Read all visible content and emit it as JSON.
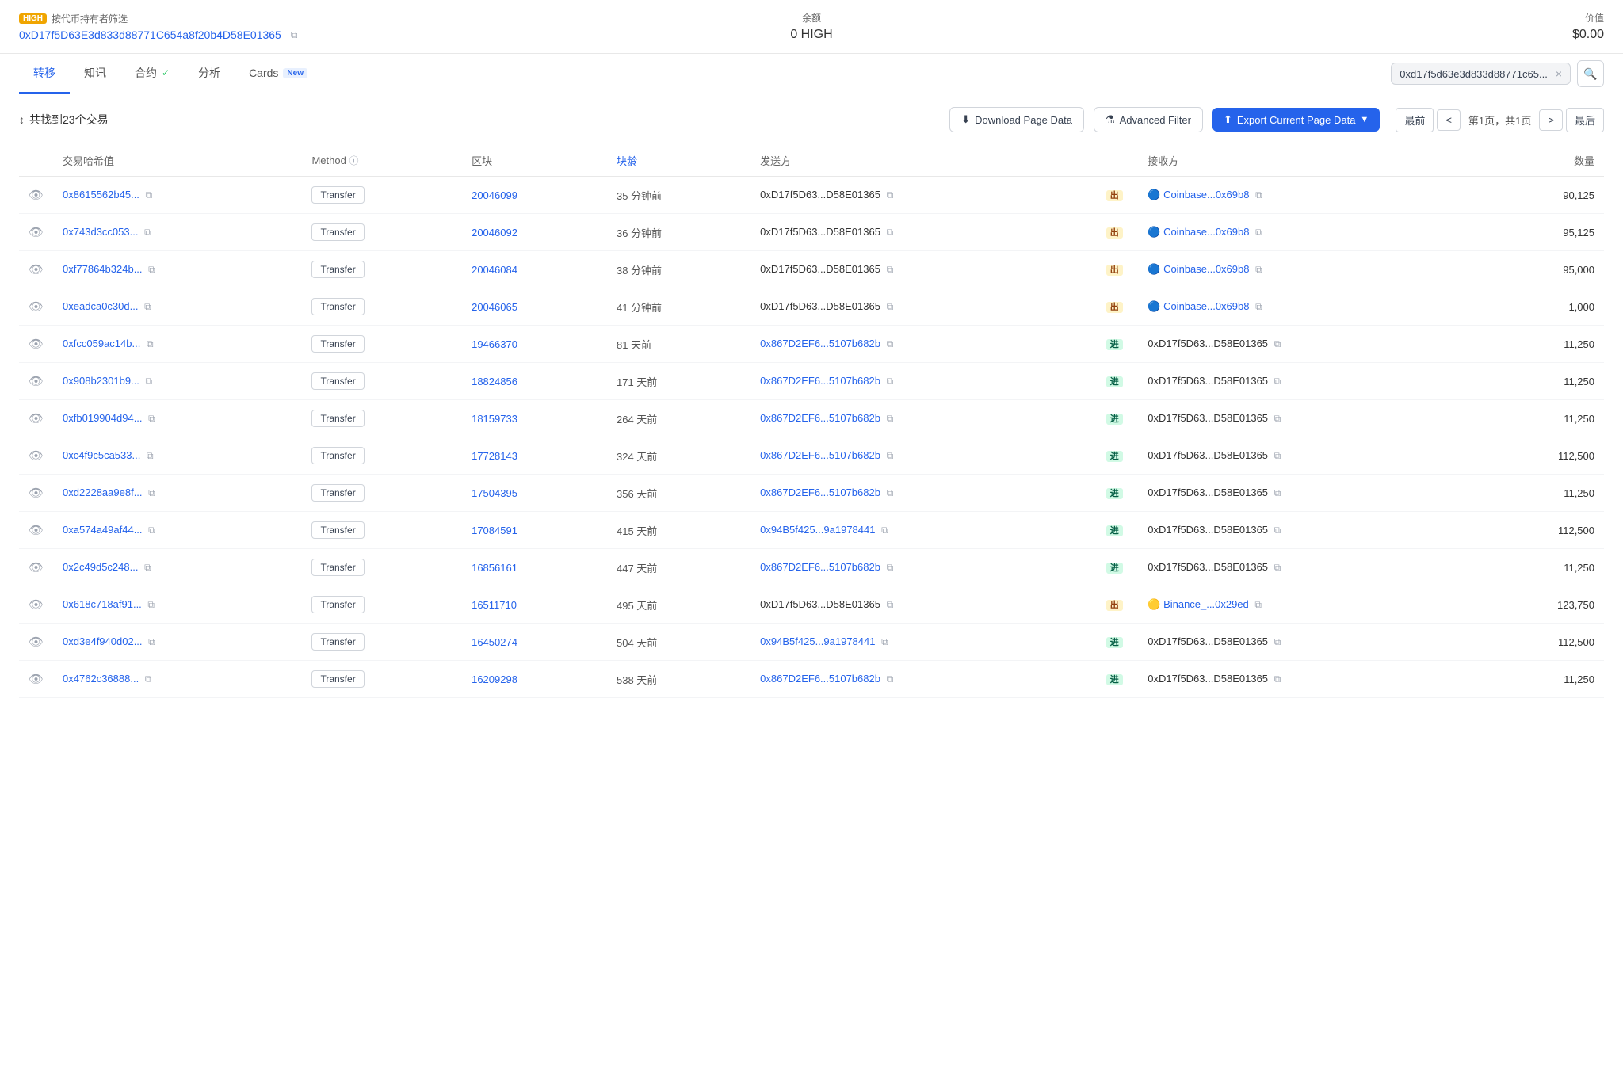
{
  "topbar": {
    "filter_label": "按代币持有者筛选",
    "coin_badge": "HIGH",
    "address": "0xD17f5D63E3d833d88771C654a8f20b4D58E01365",
    "balance_label": "余额",
    "balance_value": "0 HIGH",
    "value_label": "价值",
    "value_value": "$0.00"
  },
  "nav": {
    "tabs": [
      {
        "id": "transfer",
        "label": "转移",
        "active": true,
        "check": false,
        "new": false
      },
      {
        "id": "info",
        "label": "知讯",
        "active": false,
        "check": false,
        "new": false
      },
      {
        "id": "contract",
        "label": "合约",
        "active": false,
        "check": true,
        "new": false
      },
      {
        "id": "analysis",
        "label": "分析",
        "active": false,
        "check": false,
        "new": false
      },
      {
        "id": "cards",
        "label": "Cards",
        "active": false,
        "check": false,
        "new": true
      }
    ],
    "address_chip": "0xd17f5d63e3d833d88771c65...",
    "address_chip_full": "0xd17f5d63e3d833d88771c65..."
  },
  "table_controls": {
    "sort_label": "共找到23个交易",
    "download_label": "Download Page Data",
    "filter_label": "Advanced Filter",
    "export_label": "Export Current Page Data",
    "pagination": {
      "first": "最前",
      "prev": "<",
      "page_info": "第1页，共1页",
      "next": ">",
      "last": "最后"
    }
  },
  "table": {
    "headers": [
      "",
      "交易哈希值",
      "Method",
      "区块",
      "块龄",
      "发送方",
      "",
      "接收方",
      "数量"
    ],
    "rows": [
      {
        "hash": "0x8615562b45...",
        "method": "Transfer",
        "block": "20046099",
        "age": "35 分钟前",
        "sender": "0xD17f5D63...D58E01365",
        "direction": "出",
        "receiver_icon": "coinbase",
        "receiver": "Coinbase...0x69b8",
        "quantity": "90,125"
      },
      {
        "hash": "0x743d3cc053...",
        "method": "Transfer",
        "block": "20046092",
        "age": "36 分钟前",
        "sender": "0xD17f5D63...D58E01365",
        "direction": "出",
        "receiver_icon": "coinbase",
        "receiver": "Coinbase...0x69b8",
        "quantity": "95,125"
      },
      {
        "hash": "0xf77864b324b...",
        "method": "Transfer",
        "block": "20046084",
        "age": "38 分钟前",
        "sender": "0xD17f5D63...D58E01365",
        "direction": "出",
        "receiver_icon": "coinbase",
        "receiver": "Coinbase...0x69b8",
        "quantity": "95,000"
      },
      {
        "hash": "0xeadca0c30d...",
        "method": "Transfer",
        "block": "20046065",
        "age": "41 分钟前",
        "sender": "0xD17f5D63...D58E01365",
        "direction": "出",
        "receiver_icon": "coinbase",
        "receiver": "Coinbase...0x69b8",
        "quantity": "1,000"
      },
      {
        "hash": "0xfcc059ac14b...",
        "method": "Transfer",
        "block": "19466370",
        "age": "81 天前",
        "sender": "0x867D2EF6...5107b682b",
        "sender_link": true,
        "direction": "进",
        "receiver_icon": "none",
        "receiver": "0xD17f5D63...D58E01365",
        "quantity": "11,250"
      },
      {
        "hash": "0x908b2301b9...",
        "method": "Transfer",
        "block": "18824856",
        "age": "171 天前",
        "sender": "0x867D2EF6...5107b682b",
        "sender_link": true,
        "direction": "进",
        "receiver_icon": "none",
        "receiver": "0xD17f5D63...D58E01365",
        "quantity": "11,250"
      },
      {
        "hash": "0xfb019904d94...",
        "method": "Transfer",
        "block": "18159733",
        "age": "264 天前",
        "sender": "0x867D2EF6...5107b682b",
        "sender_link": true,
        "direction": "进",
        "receiver_icon": "none",
        "receiver": "0xD17f5D63...D58E01365",
        "quantity": "11,250"
      },
      {
        "hash": "0xc4f9c5ca533...",
        "method": "Transfer",
        "block": "17728143",
        "age": "324 天前",
        "sender": "0x867D2EF6...5107b682b",
        "sender_link": true,
        "direction": "进",
        "receiver_icon": "none",
        "receiver": "0xD17f5D63...D58E01365",
        "quantity": "112,500"
      },
      {
        "hash": "0xd2228aa9e8f...",
        "method": "Transfer",
        "block": "17504395",
        "age": "356 天前",
        "sender": "0x867D2EF6...5107b682b",
        "sender_link": true,
        "direction": "进",
        "receiver_icon": "none",
        "receiver": "0xD17f5D63...D58E01365",
        "quantity": "11,250"
      },
      {
        "hash": "0xa574a49af44...",
        "method": "Transfer",
        "block": "17084591",
        "age": "415 天前",
        "sender": "0x94B5f425...9a1978441",
        "sender_link": true,
        "direction": "进",
        "receiver_icon": "none",
        "receiver": "0xD17f5D63...D58E01365",
        "quantity": "112,500"
      },
      {
        "hash": "0x2c49d5c248...",
        "method": "Transfer",
        "block": "16856161",
        "age": "447 天前",
        "sender": "0x867D2EF6...5107b682b",
        "sender_link": true,
        "direction": "进",
        "receiver_icon": "none",
        "receiver": "0xD17f5D63...D58E01365",
        "quantity": "11,250"
      },
      {
        "hash": "0x618c718af91...",
        "method": "Transfer",
        "block": "16511710",
        "age": "495 天前",
        "sender": "0xD17f5D63...D58E01365",
        "direction": "出",
        "receiver_icon": "binance",
        "receiver": "Binance_...0x29ed",
        "quantity": "123,750"
      },
      {
        "hash": "0xd3e4f940d02...",
        "method": "Transfer",
        "block": "16450274",
        "age": "504 天前",
        "sender": "0x94B5f425...9a1978441",
        "sender_link": true,
        "direction": "进",
        "receiver_icon": "none",
        "receiver": "0xD17f5D63...D58E01365",
        "quantity": "112,500"
      },
      {
        "hash": "0x4762c36888...",
        "method": "Transfer",
        "block": "16209298",
        "age": "538 天前",
        "sender": "0x867D2EF6...5107b682b",
        "sender_link": true,
        "direction": "进",
        "receiver_icon": "none",
        "receiver": "0xD17f5D63...D58E01365",
        "quantity": "11,250"
      }
    ]
  },
  "icons": {
    "eye": "👁",
    "copy": "⧉",
    "sort": "↕",
    "download": "⬇",
    "filter": "⚗",
    "export": "⬆",
    "search": "🔍",
    "close": "×",
    "check": "✓",
    "coinbase": "🔵",
    "binance": "🟡",
    "info": "ⓘ"
  }
}
